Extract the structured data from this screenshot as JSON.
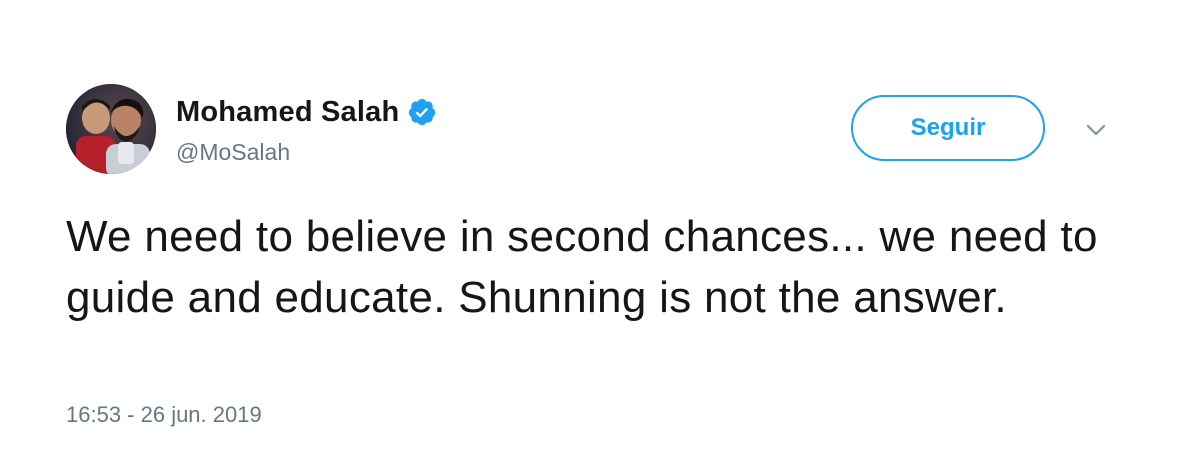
{
  "user": {
    "name": "Mohamed Salah",
    "handle": "@MoSalah",
    "verified": true
  },
  "actions": {
    "follow_label": "Seguir",
    "more_icon": "chevron-down-icon"
  },
  "tweet": {
    "text": "We need to believe in second chances... we need to guide and educate. Shunning is not the answer.",
    "timestamp": "16:53 - 26 jun. 2019"
  },
  "colors": {
    "accent": "#1da1f2",
    "text": "#14171a",
    "secondary_text": "#657786",
    "background": "#ffffff"
  }
}
